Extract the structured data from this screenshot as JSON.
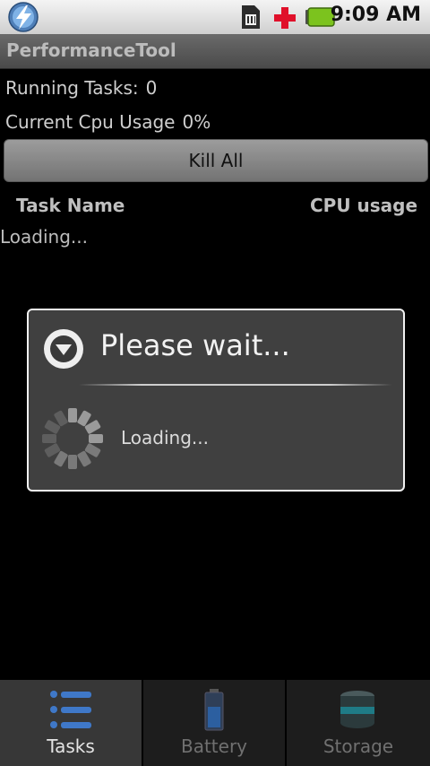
{
  "status_bar": {
    "time": "9:09 AM",
    "icons": [
      "app-lightning-icon",
      "sim-card-icon",
      "plus-icon",
      "battery-icon"
    ]
  },
  "title_bar": {
    "title": "PerformanceTool"
  },
  "info": {
    "running_tasks_label": "Running Tasks:",
    "running_tasks_value": "0",
    "cpu_usage_label": "Current Cpu Usage",
    "cpu_usage_value": "0%"
  },
  "kill_all_label": "Kill All",
  "columns": {
    "task_name": "Task Name",
    "cpu_usage": "CPU usage"
  },
  "list_loading_text": "Loading...",
  "dialog": {
    "title": "Please wait...",
    "message": "Loading...",
    "icon": "dropdown-circle-icon"
  },
  "tabs": [
    {
      "label": "Tasks",
      "icon": "list-icon",
      "active": true
    },
    {
      "label": "Battery",
      "icon": "battery-icon",
      "active": false
    },
    {
      "label": "Storage",
      "icon": "storage-icon",
      "active": false
    }
  ],
  "colors": {
    "background": "#000000",
    "dialog_bg": "#404040",
    "active_tab": "#373737",
    "battery_green": "#7cc31e",
    "plus_red": "#e0102a"
  }
}
